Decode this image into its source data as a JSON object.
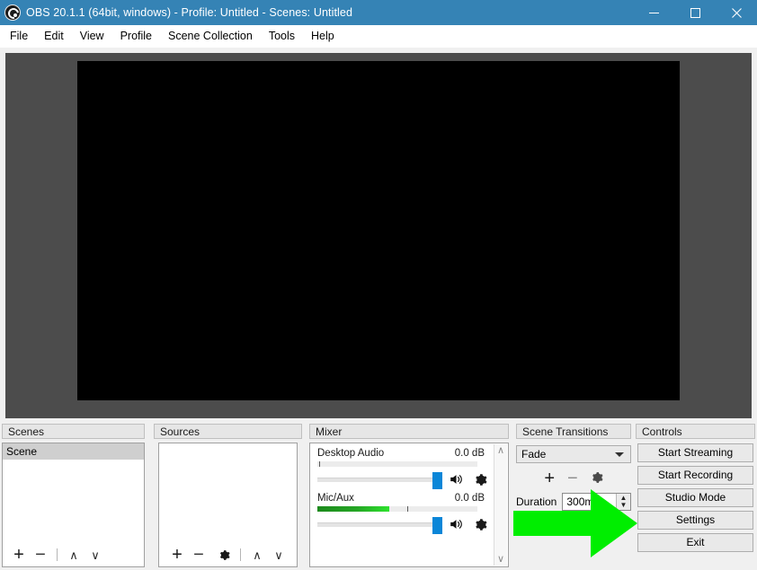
{
  "window": {
    "title": "OBS 20.1.1 (64bit, windows) - Profile: Untitled - Scenes: Untitled",
    "logo_icon": "obs-logo-icon",
    "controls": [
      {
        "name": "minimize",
        "icon": "minimize-icon"
      },
      {
        "name": "maximize",
        "icon": "maximize-icon"
      },
      {
        "name": "close",
        "icon": "close-icon"
      }
    ],
    "titlebar_color": "#3583b5"
  },
  "menubar": {
    "items": [
      "File",
      "Edit",
      "View",
      "Profile",
      "Scene Collection",
      "Tools",
      "Help"
    ]
  },
  "preview": {
    "background_color": "#4c4c4c",
    "canvas_color": "#000000"
  },
  "scenes": {
    "title": "Scenes",
    "items": [
      {
        "label": "Scene",
        "selected": true
      }
    ],
    "toolbar": [
      {
        "name": "add-scene",
        "glyph": "+"
      },
      {
        "name": "remove-scene",
        "glyph": "−"
      },
      {
        "name": "move-scene-up",
        "glyph": "∧"
      },
      {
        "name": "move-scene-down",
        "glyph": "∨"
      }
    ]
  },
  "sources": {
    "title": "Sources",
    "items": [],
    "toolbar": [
      {
        "name": "add-source",
        "glyph": "+"
      },
      {
        "name": "remove-source",
        "glyph": "−"
      },
      {
        "name": "source-properties",
        "glyph": "gear"
      },
      {
        "name": "move-source-up",
        "glyph": "∧"
      },
      {
        "name": "move-source-down",
        "glyph": "∨"
      }
    ]
  },
  "mixer": {
    "title": "Mixer",
    "tracks": [
      {
        "name": "Desktop Audio",
        "db": "0.0 dB",
        "meter_level_pct": 0,
        "meter_tick_pct": 1,
        "slider_pct": 100,
        "mute_icon": "speaker-icon",
        "settings_icon": "gear-icon"
      },
      {
        "name": "Mic/Aux",
        "db": "0.0 dB",
        "meter_level_pct": 45,
        "meter_tick_pct": 56,
        "slider_pct": 100,
        "mute_icon": "speaker-icon",
        "settings_icon": "gear-icon"
      }
    ],
    "scrollbar": {
      "up": "∧",
      "down": "∨"
    }
  },
  "transitions": {
    "title": "Scene Transitions",
    "selected": "Fade",
    "options": [
      "Fade"
    ],
    "tools": [
      {
        "name": "add-transition",
        "glyph": "+"
      },
      {
        "name": "remove-transition",
        "glyph": "−"
      },
      {
        "name": "transition-properties",
        "glyph": "gear"
      }
    ],
    "duration_label": "Duration",
    "duration_value": "300ms"
  },
  "controls": {
    "title": "Controls",
    "buttons": [
      "Start Streaming",
      "Start Recording",
      "Studio Mode",
      "Settings",
      "Exit"
    ]
  },
  "annotation": {
    "type": "arrow",
    "direction": "right",
    "color": "#00ee00",
    "points_to": "Settings"
  }
}
